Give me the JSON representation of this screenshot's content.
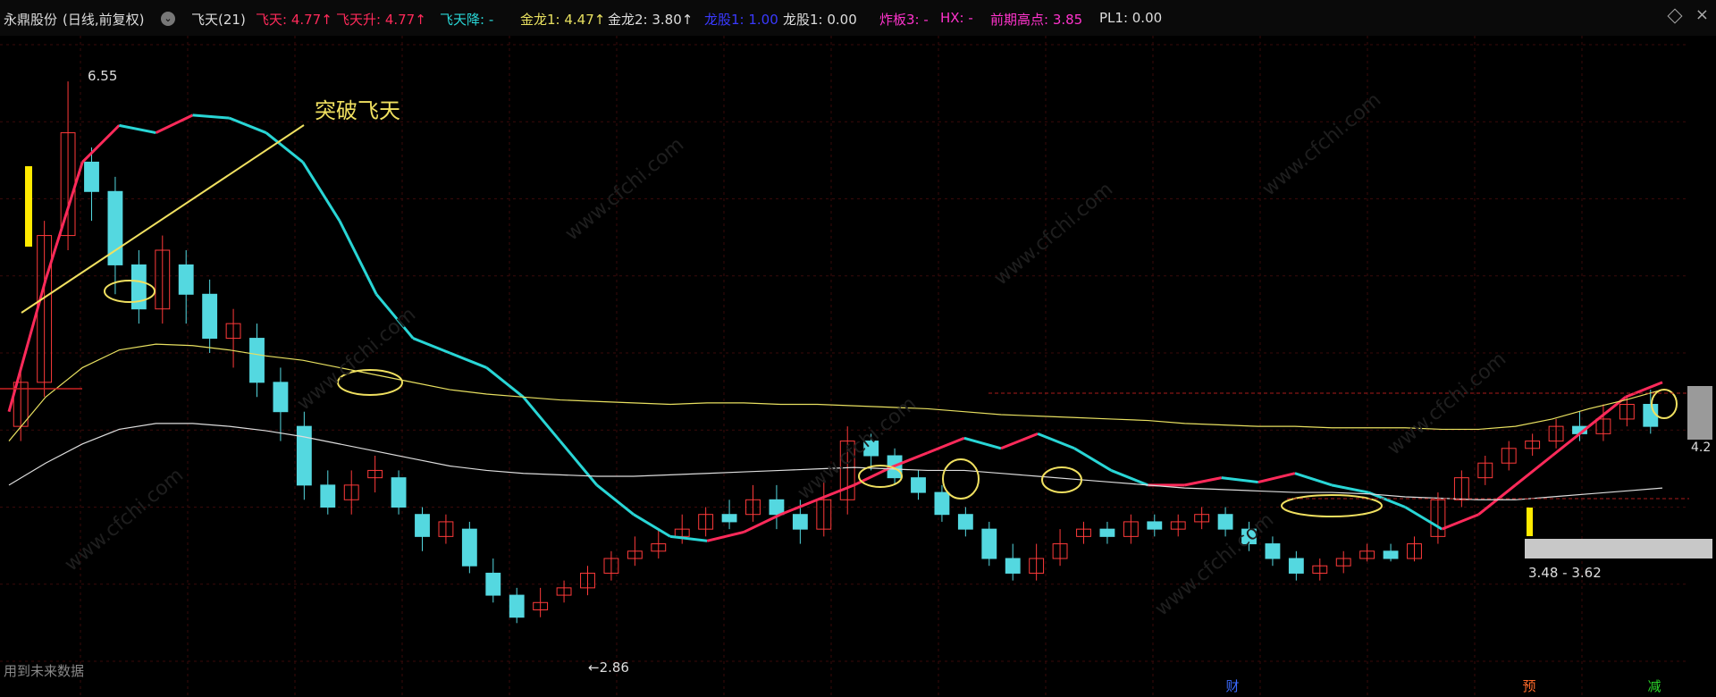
{
  "header": {
    "stock": "永鼎股份",
    "period": "(日线,前复权)",
    "indicator": "飞天(21)",
    "items": [
      {
        "label": "飞天: 4.77↑",
        "color": "#ff2a5a"
      },
      {
        "label": "飞天升: 4.77↑",
        "color": "#ff2a5a"
      },
      {
        "label": "飞天降: -",
        "color": "#29d6d6"
      },
      {
        "label": "金龙1: 4.47↑",
        "color": "#e8e060"
      },
      {
        "label": "金龙2: 3.80↑",
        "color": "#dddddd"
      },
      {
        "label": "龙股1: 1.00",
        "color": "#3a3aff"
      },
      {
        "label": "龙股1: 0.00",
        "color": "#dddddd"
      },
      {
        "label": "炸板3: -",
        "color": "#ff33cc"
      },
      {
        "label": "HX: -",
        "color": "#ff33cc"
      },
      {
        "label": "前期高点: 3.85",
        "color": "#ff33cc"
      },
      {
        "label": "PL1: 0.00",
        "color": "#dddddd"
      }
    ],
    "close_icon": "close-icon",
    "toggle_icon": "diamond-icon"
  },
  "annotations": {
    "breakout_label": "突破飞天",
    "high_label": "6.55",
    "low_label": "←2.86",
    "range_label": "3.48 - 3.62",
    "price_right": "4.2",
    "watermark": "www.cfchi.com",
    "footer_note": "用到未来数据",
    "flags": [
      {
        "label": "财",
        "color": "#3a6aff"
      },
      {
        "label": "预",
        "color": "#ff6a2a"
      },
      {
        "label": "减",
        "color": "#2ad62a"
      }
    ]
  },
  "chart_data": {
    "type": "candlestick",
    "title": "永鼎股份 (日线,前复权)",
    "ylim": [
      2.6,
      6.8
    ],
    "price_high": 6.55,
    "price_low": 2.86,
    "last_close": 4.2,
    "series": [
      {
        "name": "飞天",
        "color_up": "#ff2a5a",
        "color_down": "#29d6d6",
        "values": [
          4.3,
          5.2,
          6.0,
          6.25,
          6.2,
          6.32,
          6.3,
          6.2,
          6.0,
          5.6,
          5.1,
          4.8,
          4.7,
          4.6,
          4.4,
          4.1,
          3.8,
          3.6,
          3.45,
          3.42,
          3.48,
          3.6,
          3.7,
          3.8,
          3.92,
          4.02,
          4.12,
          4.05,
          4.15,
          4.05,
          3.9,
          3.8,
          3.8,
          3.85,
          3.82,
          3.88,
          3.8,
          3.75,
          3.65,
          3.5,
          3.6,
          3.8,
          4.0,
          4.2,
          4.4,
          4.5
        ]
      },
      {
        "name": "金龙1",
        "color": "#e8e060",
        "values": [
          4.1,
          4.4,
          4.6,
          4.72,
          4.76,
          4.75,
          4.72,
          4.68,
          4.65,
          4.6,
          4.55,
          4.5,
          4.45,
          4.42,
          4.4,
          4.38,
          4.37,
          4.36,
          4.35,
          4.36,
          4.36,
          4.35,
          4.35,
          4.34,
          4.33,
          4.32,
          4.3,
          4.28,
          4.27,
          4.26,
          4.25,
          4.24,
          4.22,
          4.21,
          4.2,
          4.2,
          4.19,
          4.19,
          4.19,
          4.18,
          4.18,
          4.2,
          4.25,
          4.32,
          4.38,
          4.45
        ]
      },
      {
        "name": "金龙2",
        "color": "#dddddd",
        "values": [
          3.8,
          3.95,
          4.08,
          4.18,
          4.22,
          4.22,
          4.2,
          4.17,
          4.13,
          4.08,
          4.03,
          3.98,
          3.93,
          3.9,
          3.88,
          3.87,
          3.86,
          3.86,
          3.87,
          3.88,
          3.89,
          3.9,
          3.91,
          3.92,
          3.91,
          3.9,
          3.9,
          3.88,
          3.86,
          3.84,
          3.82,
          3.8,
          3.78,
          3.77,
          3.76,
          3.75,
          3.75,
          3.74,
          3.72,
          3.71,
          3.7,
          3.7,
          3.72,
          3.74,
          3.76,
          3.78
        ]
      }
    ],
    "candles": [
      [
        4.2,
        4.5,
        4.1,
        4.6
      ],
      [
        4.5,
        5.5,
        4.4,
        5.6
      ],
      [
        5.5,
        6.2,
        5.4,
        6.55
      ],
      [
        6.0,
        5.8,
        5.6,
        6.1
      ],
      [
        5.8,
        5.3,
        5.1,
        5.9
      ],
      [
        5.3,
        5.0,
        4.9,
        5.4
      ],
      [
        5.0,
        5.4,
        4.9,
        5.5
      ],
      [
        5.3,
        5.1,
        4.9,
        5.4
      ],
      [
        5.1,
        4.8,
        4.7,
        5.2
      ],
      [
        4.8,
        4.9,
        4.6,
        5.0
      ],
      [
        4.8,
        4.5,
        4.4,
        4.9
      ],
      [
        4.5,
        4.3,
        4.1,
        4.6
      ],
      [
        4.2,
        3.8,
        3.7,
        4.3
      ],
      [
        3.8,
        3.65,
        3.6,
        3.9
      ],
      [
        3.7,
        3.8,
        3.6,
        3.9
      ],
      [
        3.85,
        3.9,
        3.75,
        4.0
      ],
      [
        3.85,
        3.65,
        3.6,
        3.9
      ],
      [
        3.6,
        3.45,
        3.35,
        3.65
      ],
      [
        3.45,
        3.55,
        3.4,
        3.6
      ],
      [
        3.5,
        3.25,
        3.2,
        3.55
      ],
      [
        3.2,
        3.05,
        3.0,
        3.3
      ],
      [
        3.05,
        2.9,
        2.86,
        3.1
      ],
      [
        2.95,
        3.0,
        2.9,
        3.1
      ],
      [
        3.05,
        3.1,
        3.0,
        3.15
      ],
      [
        3.1,
        3.2,
        3.05,
        3.25
      ],
      [
        3.2,
        3.3,
        3.15,
        3.35
      ],
      [
        3.3,
        3.35,
        3.25,
        3.45
      ],
      [
        3.35,
        3.4,
        3.3,
        3.5
      ],
      [
        3.45,
        3.5,
        3.4,
        3.6
      ],
      [
        3.5,
        3.6,
        3.45,
        3.65
      ],
      [
        3.6,
        3.55,
        3.5,
        3.7
      ],
      [
        3.6,
        3.7,
        3.55,
        3.8
      ],
      [
        3.7,
        3.6,
        3.5,
        3.8
      ],
      [
        3.6,
        3.5,
        3.4,
        3.7
      ],
      [
        3.5,
        3.7,
        3.45,
        3.85
      ],
      [
        3.7,
        4.1,
        3.6,
        4.2
      ],
      [
        4.1,
        4.0,
        3.9,
        4.15
      ],
      [
        4.0,
        3.85,
        3.8,
        4.05
      ],
      [
        3.85,
        3.75,
        3.7,
        3.9
      ],
      [
        3.75,
        3.6,
        3.55,
        3.8
      ],
      [
        3.6,
        3.5,
        3.45,
        3.65
      ],
      [
        3.5,
        3.3,
        3.25,
        3.55
      ],
      [
        3.3,
        3.2,
        3.15,
        3.4
      ],
      [
        3.2,
        3.3,
        3.15,
        3.4
      ],
      [
        3.3,
        3.4,
        3.25,
        3.5
      ],
      [
        3.45,
        3.5,
        3.4,
        3.55
      ],
      [
        3.5,
        3.45,
        3.4,
        3.55
      ],
      [
        3.45,
        3.55,
        3.4,
        3.6
      ],
      [
        3.55,
        3.5,
        3.45,
        3.6
      ],
      [
        3.5,
        3.55,
        3.45,
        3.6
      ],
      [
        3.55,
        3.6,
        3.5,
        3.65
      ],
      [
        3.6,
        3.5,
        3.45,
        3.65
      ],
      [
        3.5,
        3.4,
        3.35,
        3.55
      ],
      [
        3.4,
        3.3,
        3.25,
        3.45
      ],
      [
        3.3,
        3.2,
        3.15,
        3.35
      ],
      [
        3.2,
        3.25,
        3.15,
        3.3
      ],
      [
        3.25,
        3.3,
        3.2,
        3.35
      ],
      [
        3.3,
        3.35,
        3.28,
        3.4
      ],
      [
        3.35,
        3.3,
        3.28,
        3.4
      ],
      [
        3.3,
        3.4,
        3.28,
        3.45
      ],
      [
        3.45,
        3.7,
        3.4,
        3.75
      ],
      [
        3.7,
        3.85,
        3.65,
        3.9
      ],
      [
        3.85,
        3.95,
        3.8,
        4.0
      ],
      [
        3.95,
        4.05,
        3.9,
        4.1
      ],
      [
        4.05,
        4.1,
        4.0,
        4.15
      ],
      [
        4.1,
        4.2,
        4.05,
        4.25
      ],
      [
        4.2,
        4.15,
        4.1,
        4.3
      ],
      [
        4.15,
        4.25,
        4.1,
        4.35
      ],
      [
        4.25,
        4.35,
        4.2,
        4.4
      ],
      [
        4.35,
        4.2,
        4.15,
        4.45
      ]
    ]
  }
}
